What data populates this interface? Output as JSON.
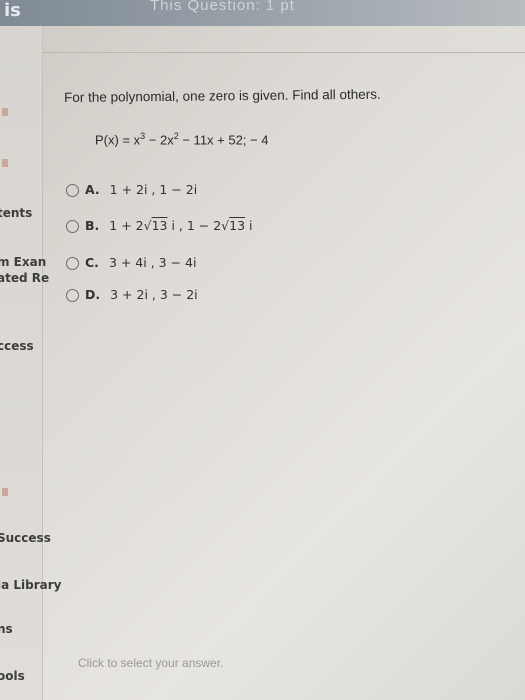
{
  "header": {
    "left_fragment": "is",
    "title_fragment": "This Question: 1 pt"
  },
  "sidebar": {
    "items": [
      {
        "label": "tents"
      },
      {
        "label": "m Exan"
      },
      {
        "label": "ated Re"
      },
      {
        "label": "ccess"
      },
      {
        "label": "Success"
      },
      {
        "label": "ia Library"
      },
      {
        "label": "ns"
      },
      {
        "label": "ools"
      }
    ]
  },
  "question": {
    "prompt": "For the polynomial, one zero is given. Find all others.",
    "polynomial_prefix": "P(x) = x",
    "exp1": "3",
    "mid1": " − 2x",
    "exp2": "2",
    "rest": " − 11x + 52;  − 4"
  },
  "options": [
    {
      "letter": "A.",
      "text": "1 + 2i , 1 − 2i"
    },
    {
      "letter": "B.",
      "pre1": "1 + 2√",
      "rad1": "13",
      "mid": " i , 1 − 2√",
      "rad2": "13",
      "post": " i"
    },
    {
      "letter": "C.",
      "text": "3 + 4i , 3 − 4i"
    },
    {
      "letter": "D.",
      "text": "3 + 2i , 3 − 2i"
    }
  ],
  "footer": {
    "hint": "Click to select your answer."
  }
}
